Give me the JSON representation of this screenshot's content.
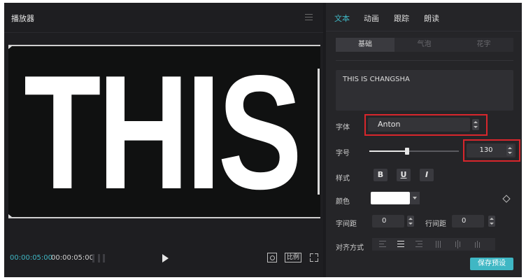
{
  "player": {
    "title": "播放器",
    "preview_text": "THIS",
    "time_current": "00:00:05:00",
    "time_total": "00:00:05:00",
    "ratio_label": "比例"
  },
  "panel": {
    "tabs": [
      {
        "label": "文本",
        "active": true
      },
      {
        "label": "动画",
        "active": false
      },
      {
        "label": "跟踪",
        "active": false
      },
      {
        "label": "朗读",
        "active": false
      }
    ],
    "subtabs": [
      {
        "label": "基础",
        "active": true
      },
      {
        "label": "气泡",
        "active": false
      },
      {
        "label": "花字",
        "active": false
      }
    ],
    "text_value": "THIS IS CHANGSHA",
    "font_label": "字体",
    "font_value": "Anton",
    "size_label": "字号",
    "size_value": "130",
    "size_slider_fraction": 0.42,
    "style_label": "样式",
    "style_bold": "B",
    "style_underline": "U",
    "style_italic": "I",
    "color_label": "颜色",
    "color_value": "#ffffff",
    "letter_spacing_label": "字间距",
    "letter_spacing_value": "0",
    "line_spacing_label": "行间距",
    "line_spacing_value": "0",
    "align_label": "对齐方式",
    "save_preset_label": "保存预设"
  },
  "colors": {
    "accent": "#3fb7c4",
    "highlight_box": "#d8262c",
    "panel_bg": "#252528"
  }
}
